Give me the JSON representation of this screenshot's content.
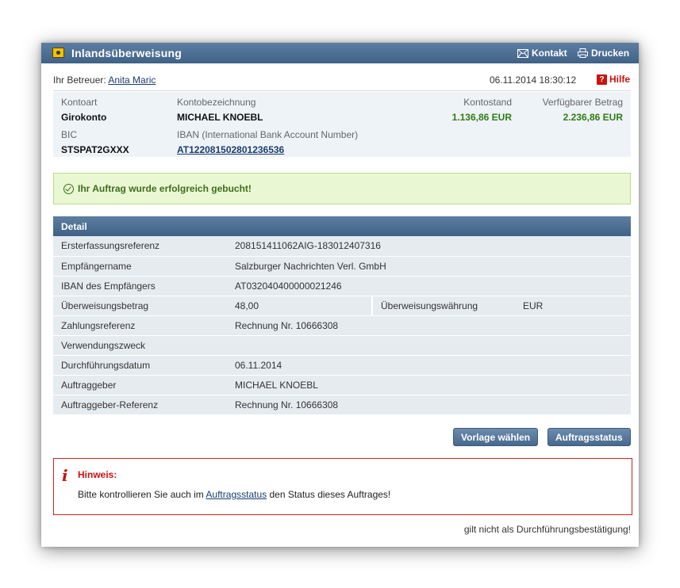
{
  "titlebar": {
    "title": "Inlandsüberweisung",
    "kontakt_label": "Kontakt",
    "drucken_label": "Drucken"
  },
  "info": {
    "betreuer_prefix": "Ihr Betreuer:",
    "betreuer_name": "Anita Maric",
    "datetime": "06.11.2014 18:30:12",
    "hilfe_label": "Hilfe"
  },
  "account": {
    "kontoart_label": "Kontoart",
    "kontoart_value": "Girokonto",
    "bezeichnung_label": "Kontobezeichnung",
    "bezeichnung_value": "MICHAEL KNOEBL",
    "kontostand_label": "Kontostand",
    "kontostand_value": "1.136,86 EUR",
    "verfuegbar_label": "Verfügbarer Betrag",
    "verfuegbar_value": "2.236,86 EUR",
    "bic_label": "BIC",
    "bic_value": "STSPAT2GXXX",
    "iban_label": "IBAN (International Bank Account Number)",
    "iban_value": "AT122081502801236536"
  },
  "success_message": "Ihr Auftrag wurde erfolgreich gebucht!",
  "detail": {
    "header": "Detail",
    "rows": [
      {
        "label": "Ersterfassungsreferenz",
        "value": "208151411062AIG-183012407316"
      },
      {
        "label": "Empfängername",
        "value": "Salzburger Nachrichten Verl. GmbH"
      },
      {
        "label": "IBAN des Empfängers",
        "value": "AT032040400000021246"
      },
      {
        "label": "Überweisungsbetrag",
        "value": "48,00",
        "label2": "Überweisungswährung",
        "value2": "EUR"
      },
      {
        "label": "Zahlungsreferenz",
        "value": "Rechnung Nr. 10666308"
      },
      {
        "label": "Verwendungszweck",
        "value": ""
      },
      {
        "label": "Durchführungsdatum",
        "value": "06.11.2014"
      },
      {
        "label": "Auftraggeber",
        "value": "MICHAEL KNOEBL"
      },
      {
        "label": "Auftraggeber-Referenz",
        "value": "Rechnung Nr. 10666308"
      }
    ]
  },
  "buttons": {
    "vorlage": "Vorlage wählen",
    "auftragsstatus": "Auftragsstatus"
  },
  "hinweis": {
    "title": "Hinweis:",
    "text_before": "Bitte kontrollieren Sie auch im",
    "link": "Auftragsstatus",
    "text_after": "den Status dieses Auftrages!"
  },
  "footer_note": "gilt nicht als Durchführungsbestätigung!",
  "colors": {
    "header_blue": "#4a6d92",
    "success_green": "#3f6d1c",
    "amount_green": "#2e7d12",
    "alert_red": "#cc1111"
  }
}
